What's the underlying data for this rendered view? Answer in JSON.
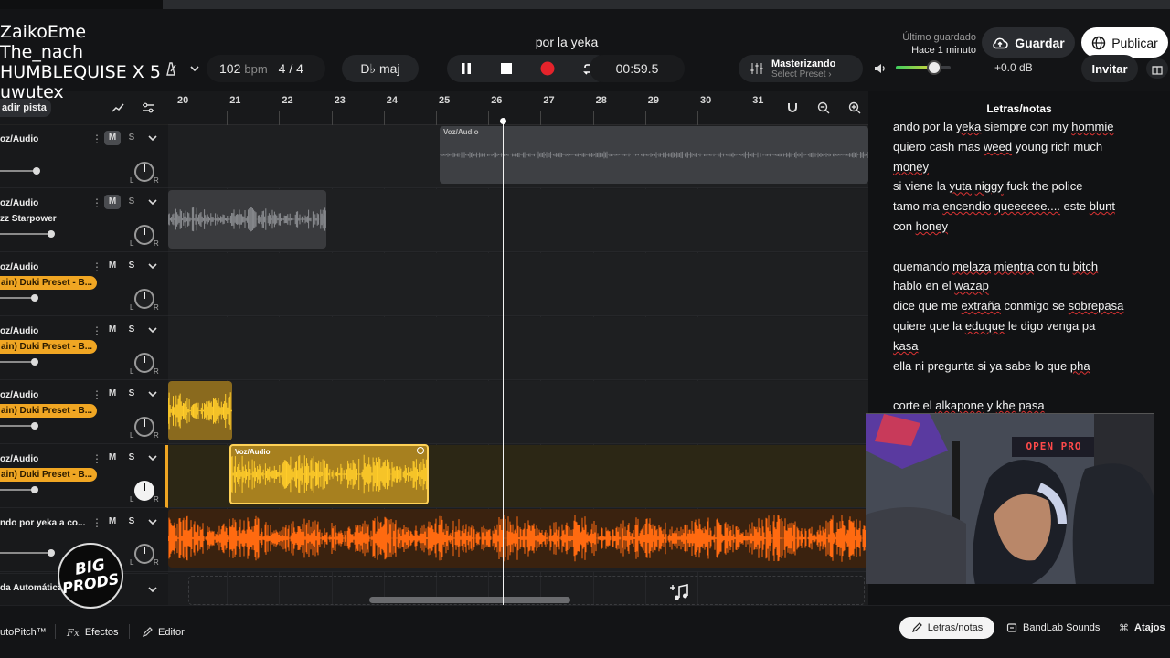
{
  "overlay_names": [
    "ZaikoEme",
    "The_nach",
    "HUMBLEQUISE X 5",
    "uwutex"
  ],
  "header": {
    "song_title": "por la yeka",
    "last_saved_label": "Último guardado",
    "last_saved_value": "Hace 1 minuto",
    "save_label": "Guardar",
    "publish_label": "Publicar",
    "tempo_value": "102",
    "tempo_unit": "bpm",
    "time_signature": "4 / 4",
    "key": "D♭ maj",
    "time_display": "00:59.5",
    "mastering_title": "Masterizando",
    "mastering_preset": "Select Preset ›",
    "master_volume_db": "+0.0 dB",
    "master_volume_level": 0.7,
    "invite_label": "Invitar"
  },
  "add_track_label": "adir pista",
  "ruler": {
    "bars": [
      "20",
      "21",
      "22",
      "23",
      "24",
      "25",
      "26",
      "27",
      "28",
      "29",
      "30",
      "31"
    ]
  },
  "tracks": [
    {
      "name": "oz/Audio",
      "sub": "",
      "preset": "",
      "m_on": true,
      "s": "S",
      "m": "M",
      "fader": 0.5,
      "pan_white": false
    },
    {
      "name": "oz/Audio",
      "sub": "zz Starpower",
      "preset": "",
      "m_on": true,
      "s": "S",
      "m": "M",
      "fader": 0.7,
      "pan_white": false
    },
    {
      "name": "oz/Audio",
      "sub": "",
      "preset": "ain) Duki Preset - B...",
      "m_on": false,
      "s": "S",
      "m": "M",
      "fader": 0.48,
      "pan_white": false
    },
    {
      "name": "oz/Audio",
      "sub": "",
      "preset": "ain) Duki Preset - B...",
      "m_on": false,
      "s": "S",
      "m": "M",
      "fader": 0.48,
      "pan_white": false
    },
    {
      "name": "oz/Audio",
      "sub": "",
      "preset": "ain) Duki Preset - B...",
      "m_on": false,
      "s": "S",
      "m": "M",
      "fader": 0.48,
      "pan_white": false
    },
    {
      "name": "oz/Audio",
      "sub": "",
      "preset": "ain) Duki Preset - B...",
      "m_on": false,
      "s": "S",
      "m": "M",
      "fader": 0.48,
      "pan_white": true
    },
    {
      "name": "ndo por yeka a co...",
      "sub": "",
      "preset": "",
      "m_on": false,
      "s": "S",
      "m": "M",
      "fader": 0.7,
      "pan_white": false
    }
  ],
  "clips": {
    "clip1_label": "Voz/Audio",
    "clip6_label": "Voz/Audio"
  },
  "automation_label": "da Automática",
  "lyrics": {
    "title": "Letras/notas",
    "lines": [
      "ando por la  yeka siempre con my hommie",
      "quiero cash mas weed  young rich  much",
      "money",
      "si viene la yuta niggy fuck the police",
      " tamo ma encendio queeeeee.... este blunt",
      "con honey",
      "",
      "quemando melaza mientra con tu bitch",
      "hablo en el wazap",
      "dice que me extraña conmigo se sobrepasa",
      " quiere que la eduque le digo venga pa",
      "kasa",
      "ella ni pregunta si ya sabe lo que pha",
      "",
      " corte el alkapone y khe pasa"
    ]
  },
  "bottom": {
    "autopitch_label": "utoPitch™",
    "effects_label": "Efectos",
    "editor_label": "Editor",
    "lyrics_tab_label": "Letras/notas",
    "sounds_label": "BandLab Sounds",
    "shortcuts_label": "Atajos"
  },
  "logo": {
    "line1": "BIG",
    "line2": "PRODS"
  },
  "webcam_sign": "OPEN PRO",
  "colors": {
    "accent": "#f0a623",
    "orange_track": "#ff6a10",
    "record": "#e5232b",
    "bg": "#0f1011"
  }
}
